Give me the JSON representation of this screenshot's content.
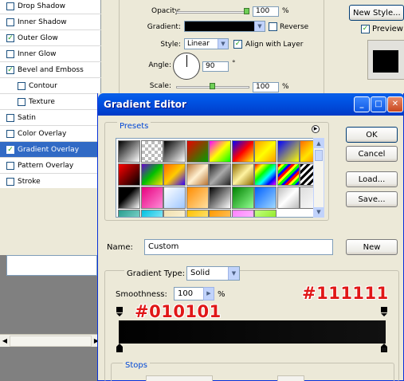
{
  "layer_style": {
    "styles": [
      {
        "label": "Drop Shadow",
        "checked": false,
        "indent": false,
        "selected": false
      },
      {
        "label": "Inner Shadow",
        "checked": false,
        "indent": false,
        "selected": false
      },
      {
        "label": "Outer Glow",
        "checked": true,
        "indent": false,
        "selected": false
      },
      {
        "label": "Inner Glow",
        "checked": false,
        "indent": false,
        "selected": false
      },
      {
        "label": "Bevel and Emboss",
        "checked": true,
        "indent": false,
        "selected": false
      },
      {
        "label": "Contour",
        "checked": false,
        "indent": true,
        "selected": false
      },
      {
        "label": "Texture",
        "checked": false,
        "indent": true,
        "selected": false
      },
      {
        "label": "Satin",
        "checked": false,
        "indent": false,
        "selected": false
      },
      {
        "label": "Color Overlay",
        "checked": false,
        "indent": false,
        "selected": false
      },
      {
        "label": "Gradient Overlay",
        "checked": true,
        "indent": false,
        "selected": true
      },
      {
        "label": "Pattern Overlay",
        "checked": false,
        "indent": false,
        "selected": false
      },
      {
        "label": "Stroke",
        "checked": false,
        "indent": false,
        "selected": false
      }
    ],
    "gradient_overlay": {
      "opacity_label": "Opacity:",
      "opacity_value": "100",
      "opacity_unit": "%",
      "opacity_level": 1.0,
      "gradient_label": "Gradient:",
      "reverse_label": "Reverse",
      "reverse_checked": false,
      "style_label": "Style:",
      "style_value": "Linear",
      "align_label": "Align with Layer",
      "align_checked": true,
      "angle_label": "Angle:",
      "angle_value": "90",
      "angle_unit": "°",
      "scale_label": "Scale:",
      "scale_value": "100",
      "scale_unit": "%",
      "scale_level": 0.5
    },
    "new_style_label": "New Style...",
    "preview_label": "Preview",
    "preview_checked": true
  },
  "gradient_editor": {
    "title": "Gradient Editor",
    "presets_label": "Presets",
    "buttons": {
      "ok": "OK",
      "cancel": "Cancel",
      "load": "Load...",
      "save": "Save...",
      "new": "New"
    },
    "name_label": "Name:",
    "name_value": "Custom",
    "gradient_type_label": "Gradient Type:",
    "gradient_type_value": "Solid",
    "smoothness_label": "Smoothness:",
    "smoothness_value": "100",
    "smoothness_unit": "%",
    "stops_label": "Stops",
    "left_stop_color": "#010101",
    "right_stop_color": "#111111",
    "annotation_left": "#010101",
    "annotation_right": "#111111",
    "preset_swatches": [
      "linear-gradient(135deg,#000,#fff)",
      "repeating-conic-gradient(#bbb 0 25%,#fff 0 50%) 0 0/8px 8px",
      "linear-gradient(135deg,#000,#fff)",
      "linear-gradient(135deg,#e80000,#00a000)",
      "linear-gradient(135deg,#ff00ff,#ffff00,#00ff00)",
      "linear-gradient(135deg,#0000ff,#ff0000,#ffff00)",
      "linear-gradient(135deg,#f90,#ff0,#f90)",
      "linear-gradient(135deg,#0000ff,#ffff00)",
      "linear-gradient(135deg,#ff6a00,#ffe400,#ff6a00)",
      "linear-gradient(135deg,#ff0000,#000)",
      "linear-gradient(135deg,#6a00d5,#00c000,#ffe000)",
      "linear-gradient(135deg,#ff6600,#ffcc00,#3300ff)",
      "linear-gradient(135deg,#b87333,#fff0d0,#b87333)",
      "linear-gradient(135deg,#222,#aaa,#222)",
      "linear-gradient(135deg,#8f6b00,#fff3a0,#8f6b00)",
      "linear-gradient(135deg,#ff0000,#ffff00,#00ff00,#00ffff,#0000ff,#ff00ff)",
      "repeating-linear-gradient(135deg,#f00 0 3px,#ff0 3px 6px,#0f0 6px 9px,#00f 9px 12px)",
      "repeating-linear-gradient(135deg,#000 0 3px,#fff 3px 6px)",
      "linear-gradient(135deg,#000,#000 40%,#fff)",
      "linear-gradient(135deg,#e6007e,#ff8ad8)",
      "linear-gradient(135deg,#fff,#9fc7ff)",
      "linear-gradient(135deg,#ff8c00,#ffe0a0)",
      "linear-gradient(135deg,#000,#fff)",
      "linear-gradient(135deg,#008000,#90ff90)",
      "linear-gradient(135deg,#0060ff,#a0d8ff)",
      "linear-gradient(135deg,#bbb,#fff,#bbb)",
      "linear-gradient(135deg,#ddd,#fff)",
      "linear-gradient(135deg,#2a9d8f,#a0e8e0)",
      "linear-gradient(135deg,#00c0e0,#c0f8ff)",
      "linear-gradient(135deg,#f0e0b0,#fff8e0)",
      "linear-gradient(135deg,#ffc000,#fff0a0)",
      "linear-gradient(135deg,#ff9900,#ffd080)",
      "linear-gradient(135deg,#ff80ff,#ffd0ff)",
      "linear-gradient(135deg,#c0ff80,#80e000)"
    ]
  }
}
